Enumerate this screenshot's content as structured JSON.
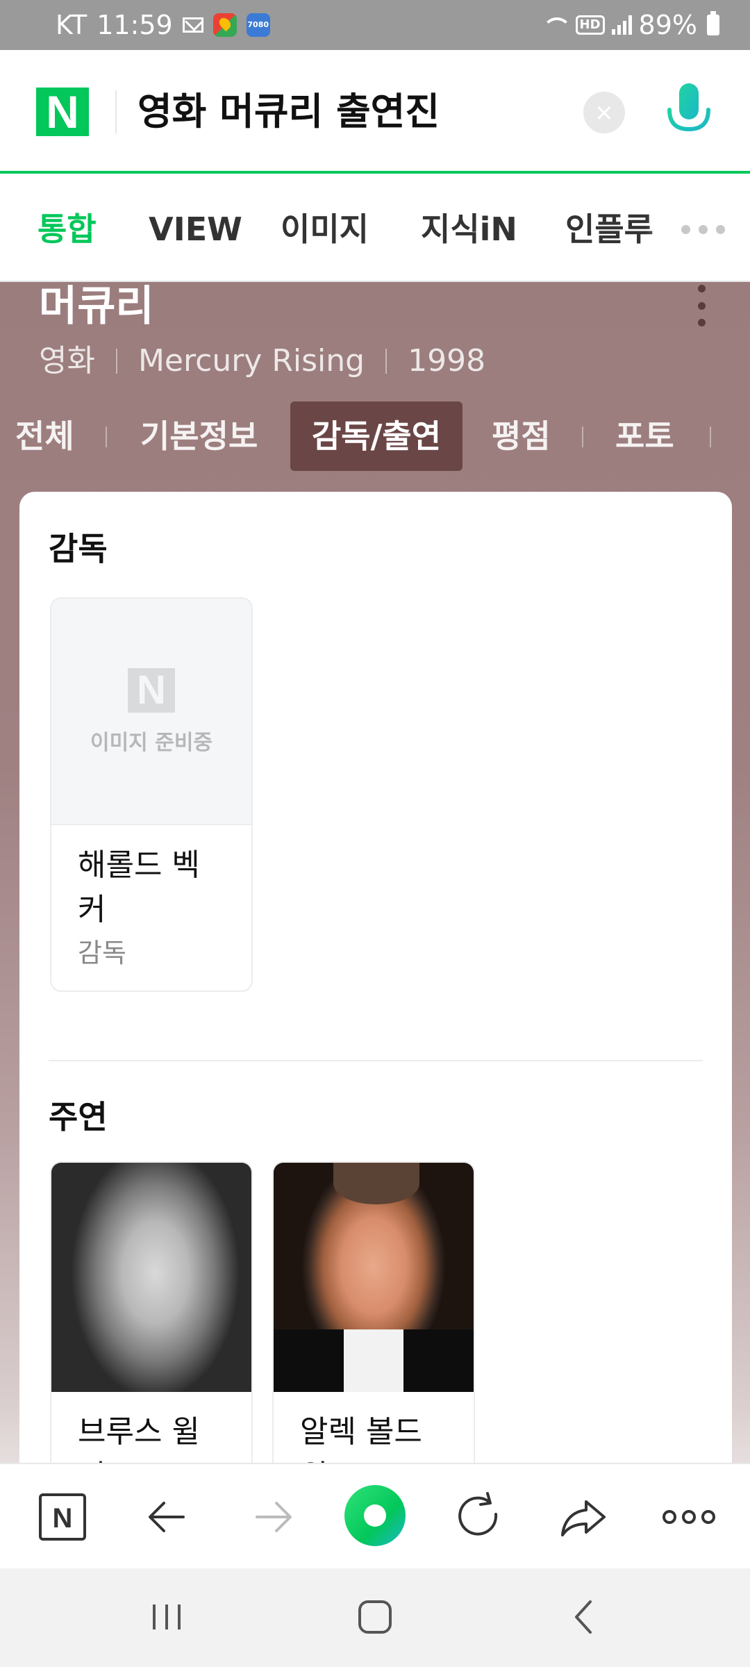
{
  "status_bar": {
    "carrier": "KT",
    "time": "11:59",
    "badge_7080": "7080",
    "hd_label": "HD",
    "battery": "89%"
  },
  "search": {
    "logo": "N",
    "query": "영화 머큐리 출연진"
  },
  "category_tabs": [
    {
      "label": "통합",
      "active": true
    },
    {
      "label": "VIEW"
    },
    {
      "label": "이미지"
    },
    {
      "label": "지식iN"
    },
    {
      "label": "인플루"
    }
  ],
  "movie": {
    "title": "머큐리",
    "genre": "영화",
    "original_title": "Mercury Rising",
    "year": "1998"
  },
  "section_tabs": [
    {
      "label": "전체"
    },
    {
      "label": "기본정보"
    },
    {
      "label": "감독/출연",
      "active": true
    },
    {
      "label": "평점"
    },
    {
      "label": "포토"
    }
  ],
  "director_section": {
    "heading": "감독",
    "placeholder_logo": "N",
    "placeholder_text": "이미지 준비중",
    "people": [
      {
        "name": "해롤드 벡커",
        "role": "감독"
      }
    ]
  },
  "cast_section": {
    "heading": "주연",
    "people": [
      {
        "name": "브루스 윌리스"
      },
      {
        "name": "알렉 볼드윈"
      }
    ]
  },
  "toolbar": {
    "home_logo": "N"
  },
  "colors": {
    "naver_green": "#03c75a",
    "active_tab_bg": "#6b4646",
    "header_gradient_top": "#9c7d7d"
  }
}
